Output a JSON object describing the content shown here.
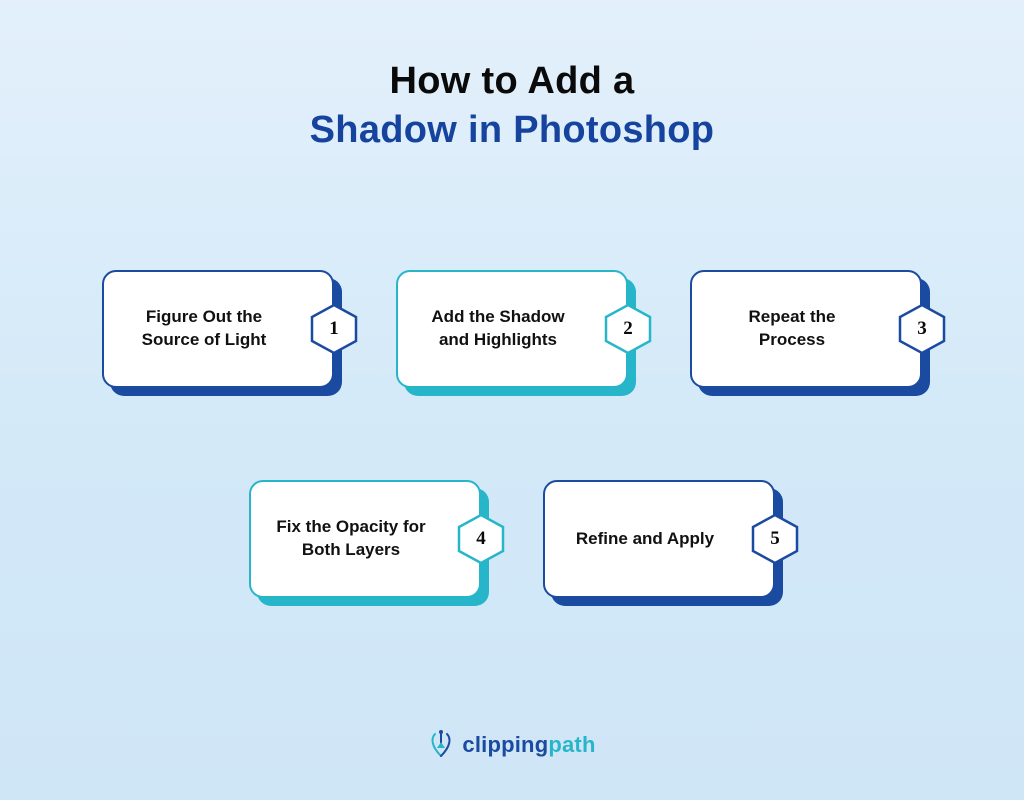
{
  "title": {
    "line1": "How to Add a",
    "line2": "Shadow in Photoshop"
  },
  "steps": [
    {
      "n": "1",
      "label": "Figure Out the Source of Light",
      "scheme": "navy"
    },
    {
      "n": "2",
      "label": "Add the Shadow and Highlights",
      "scheme": "teal"
    },
    {
      "n": "3",
      "label": "Repeat the Process",
      "scheme": "navy"
    },
    {
      "n": "4",
      "label": "Fix the Opacity for Both Layers",
      "scheme": "teal"
    },
    {
      "n": "5",
      "label": "Refine and Apply",
      "scheme": "navy"
    }
  ],
  "brand": {
    "part1": "clipping",
    "part2": "path"
  },
  "colors": {
    "navy": "#1b4aa1",
    "teal": "#27b6c9"
  }
}
